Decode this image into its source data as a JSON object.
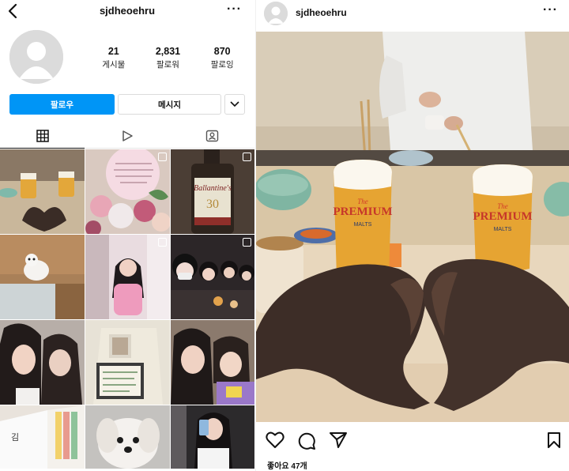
{
  "profile": {
    "username": "sjdheoehru",
    "more_icon": "···",
    "stats": [
      {
        "number": "21",
        "label": "게시물"
      },
      {
        "number": "2,831",
        "label": "팔로워"
      },
      {
        "number": "870",
        "label": "팔로잉"
      }
    ],
    "follow_label": "팔로우",
    "message_label": "메시지",
    "tabs": [
      "grid-icon",
      "reels-icon",
      "tagged-icon"
    ]
  },
  "post": {
    "username": "sjdheoehru",
    "more_icon": "···",
    "likes": "좋아요 47개",
    "glass_brand_top": "The",
    "glass_brand": "PREMIUM",
    "glass_sub": "MALTS"
  },
  "grid_cells": [
    {
      "name": "grid-post-1",
      "desc": "beers heart hands",
      "multi": false
    },
    {
      "name": "grid-post-2",
      "desc": "flowers card",
      "multi": true
    },
    {
      "name": "grid-post-3",
      "desc": "whisky bottle",
      "multi": true,
      "text": "Ballantine's"
    },
    {
      "name": "grid-post-4",
      "desc": "small dog on floor",
      "multi": false
    },
    {
      "name": "grid-post-5",
      "desc": "girl in pink room",
      "multi": true
    },
    {
      "name": "grid-post-6",
      "desc": "group selfie",
      "multi": true
    },
    {
      "name": "grid-post-7",
      "desc": "two girls selfie",
      "multi": false
    },
    {
      "name": "grid-post-8",
      "desc": "note card bag",
      "multi": false
    },
    {
      "name": "grid-post-9",
      "desc": "girl with child",
      "multi": false
    },
    {
      "name": "grid-post-10",
      "desc": "book pages",
      "multi": false
    },
    {
      "name": "grid-post-11",
      "desc": "white dog",
      "multi": false
    },
    {
      "name": "grid-post-12",
      "desc": "mirror selfie",
      "multi": false
    }
  ],
  "colors": {
    "follow_blue": "#0095f6",
    "border": "#dbdbdb"
  }
}
